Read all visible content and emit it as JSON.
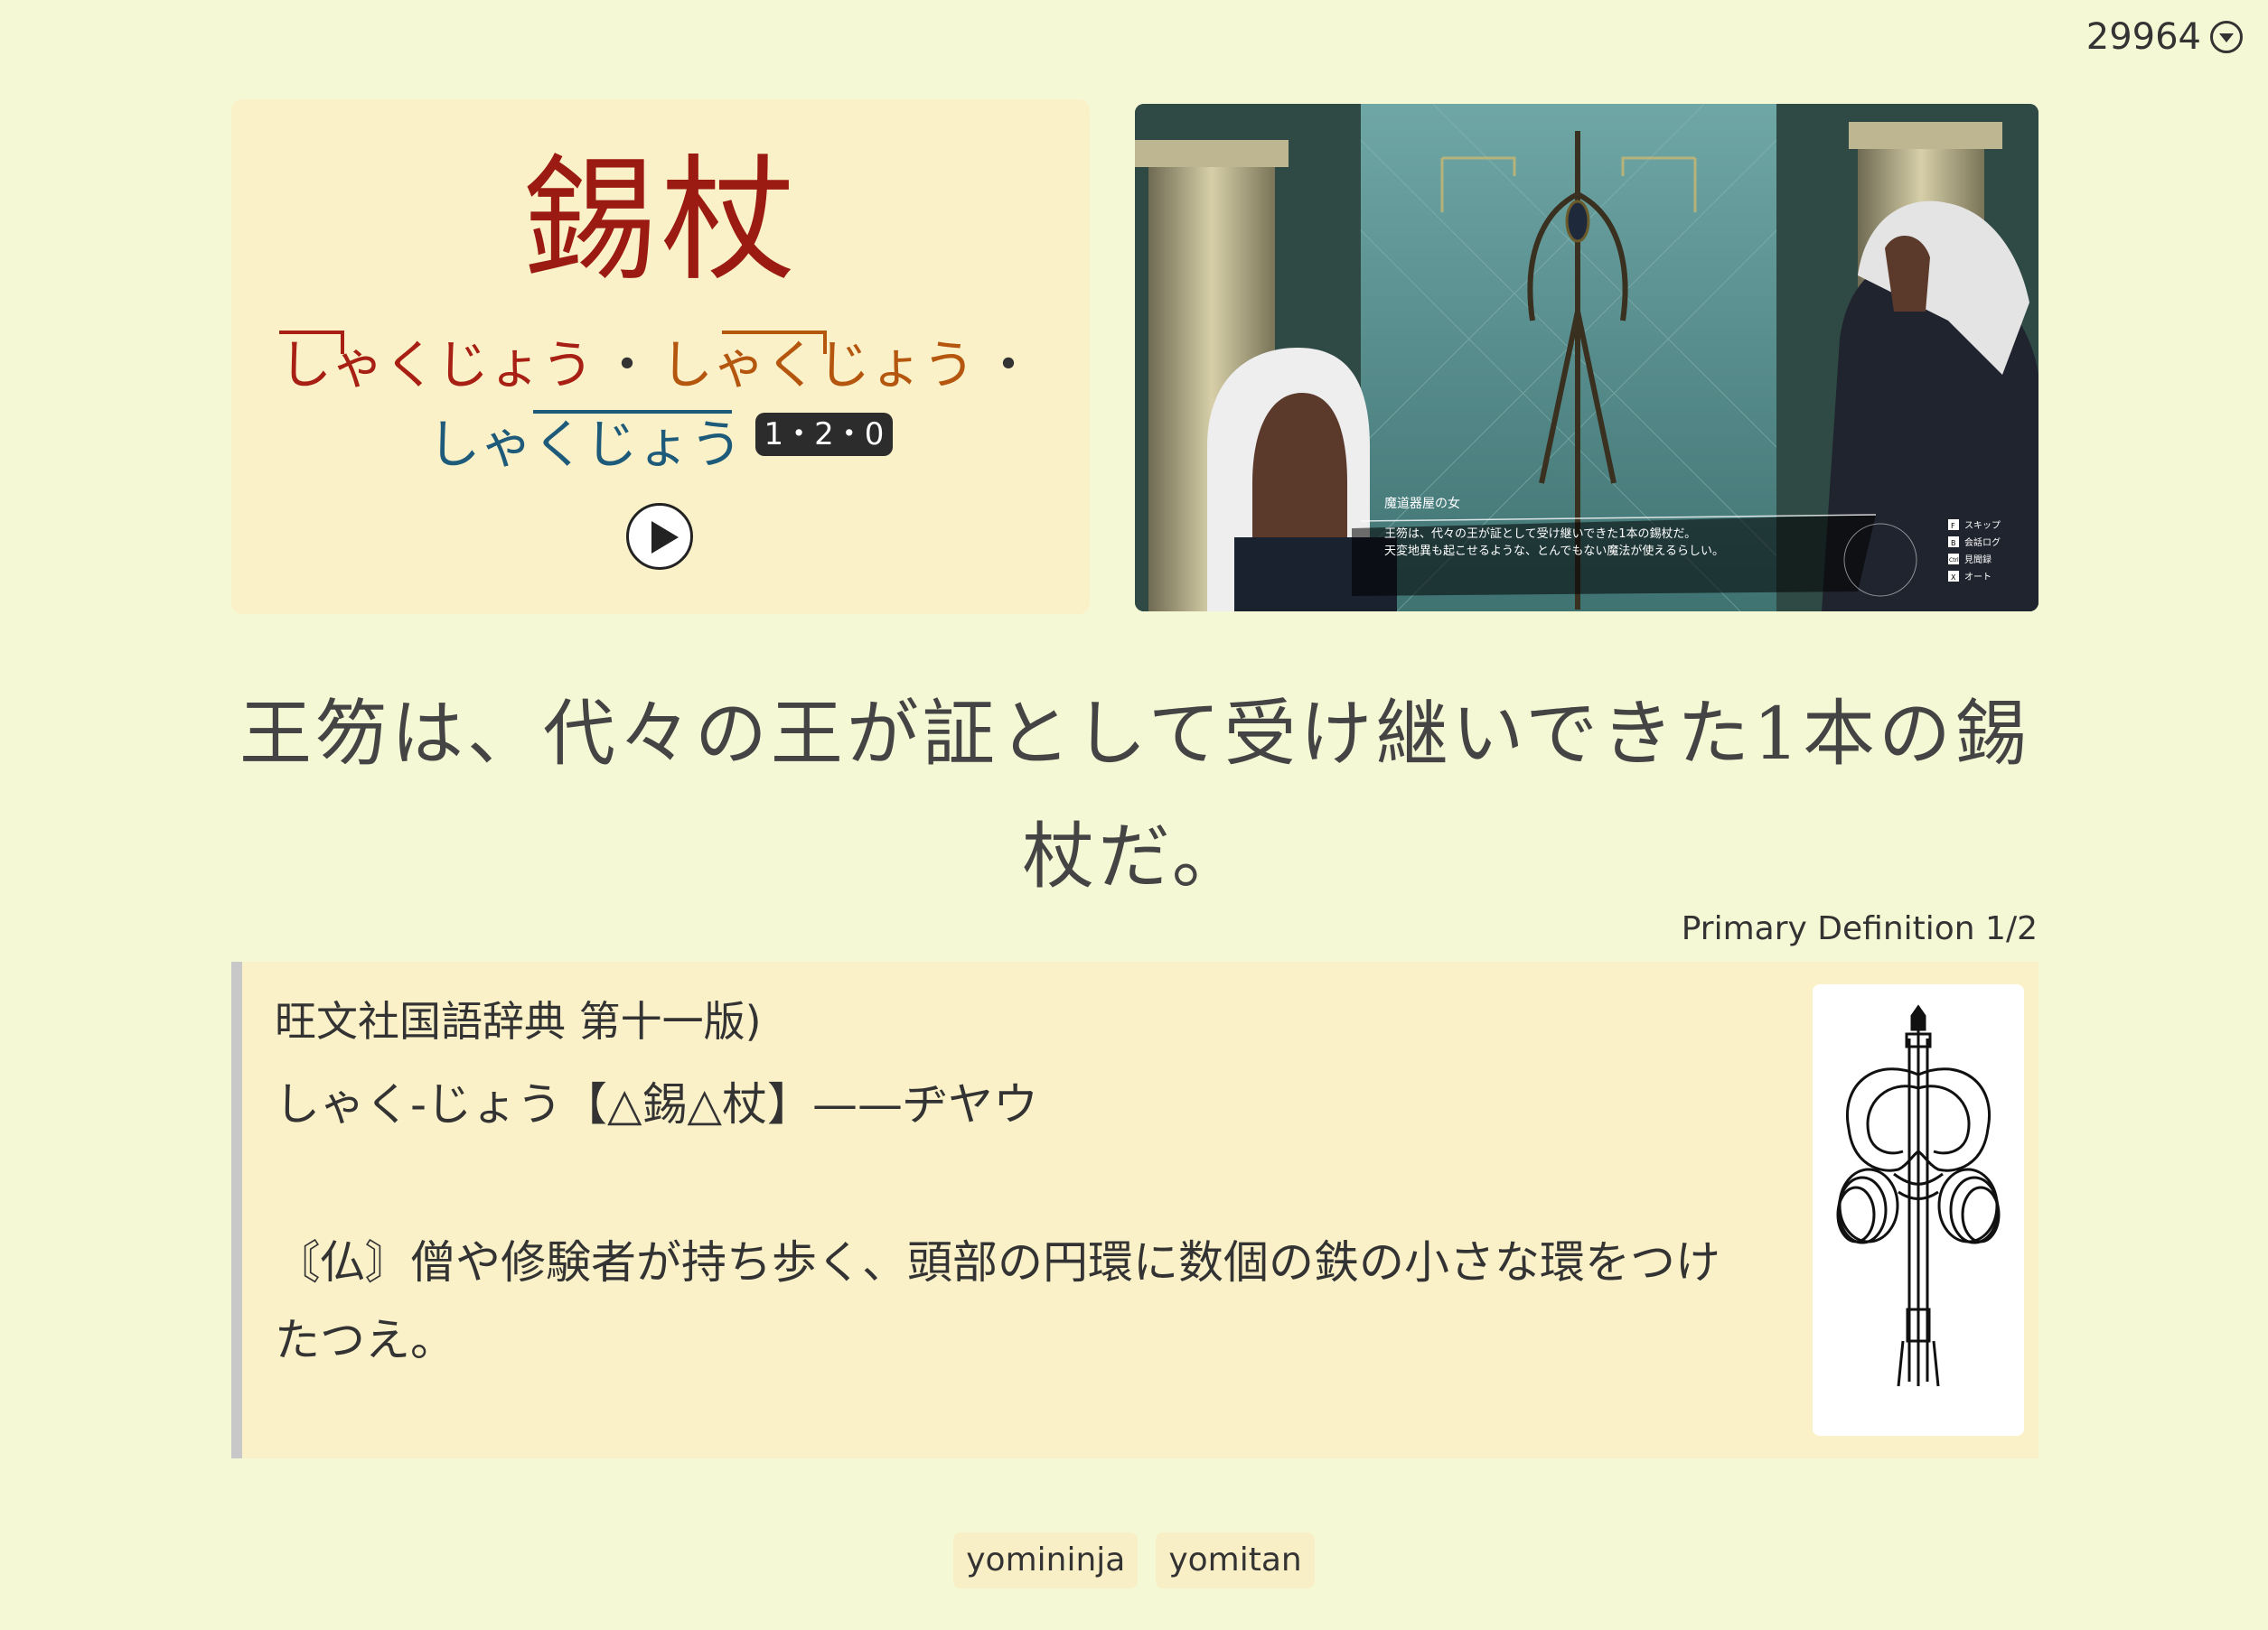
{
  "counter": {
    "value": "29964"
  },
  "word": {
    "kanji": "錫杖",
    "readings": [
      "しゃくじょう",
      "しゃくじょう",
      "しゃくじょう"
    ],
    "separator": "・",
    "pitch": "1・2・0"
  },
  "screenshot": {
    "speaker": "魔道器屋の女",
    "line1": "王笏は、代々の王が証として受け継いできた1本の錫杖だ。",
    "line2": "天変地異も起こせるような、とんでもない魔法が使えるらしい。",
    "controls": [
      {
        "key": "F",
        "label": "スキップ"
      },
      {
        "key": "B",
        "label": "会話ログ"
      },
      {
        "key": "Ctrl",
        "label": "見聞録"
      },
      {
        "key": "X",
        "label": "オート"
      }
    ]
  },
  "sentence": {
    "text": "王笏は、代々の王が証として受け継いできた1本の錫杖だ。"
  },
  "definition": {
    "label": "Primary Definition 1/2",
    "source": "旺文社国語辞典 第十一版)",
    "heading": "しゃく-じょう【△錫△杖】——ヂヤウ",
    "body": "〘仏〙僧や修験者が持ち歩く、頭部の円環に数個の鉄の小さな環をつけたつえ。"
  },
  "tags": [
    "yomininja",
    "yomitan"
  ],
  "colors": {
    "background": "#f5f8d5",
    "card": "#faf1c8",
    "kanji": "#9b1a12",
    "reading_1": "#a81f14",
    "reading_2": "#b5560e",
    "reading_3": "#1e5a7a"
  }
}
